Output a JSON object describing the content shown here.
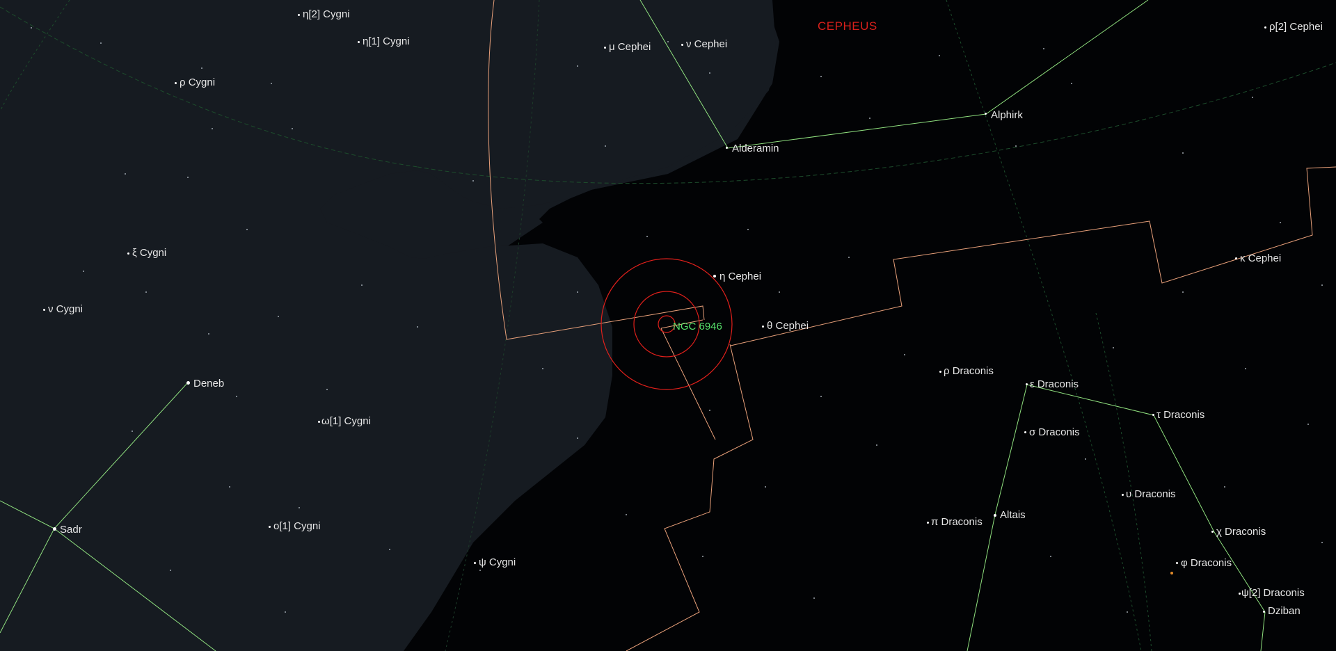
{
  "constellation_label": "CEPHEUS",
  "target": {
    "name": "NGC 6946"
  },
  "stars": [
    {
      "id": "eta2-cygni",
      "name": "η[2] Cygni"
    },
    {
      "id": "eta1-cygni",
      "name": "η[1] Cygni"
    },
    {
      "id": "rho-cygni",
      "name": "ρ Cygni"
    },
    {
      "id": "xi-cygni",
      "name": "ξ Cygni"
    },
    {
      "id": "nu-cygni",
      "name": "ν Cygni"
    },
    {
      "id": "deneb",
      "name": "Deneb"
    },
    {
      "id": "omega1-cygni",
      "name": "ω[1] Cygni"
    },
    {
      "id": "sadr",
      "name": "Sadr"
    },
    {
      "id": "o1-cygni",
      "name": "o[1] Cygni"
    },
    {
      "id": "psi-cygni",
      "name": "ψ Cygni"
    },
    {
      "id": "mu-cephei",
      "name": "μ Cephei"
    },
    {
      "id": "nu-cephei",
      "name": "ν Cephei"
    },
    {
      "id": "alderamin",
      "name": "Alderamin"
    },
    {
      "id": "alphirk",
      "name": "Alphirk"
    },
    {
      "id": "rho2-cephei",
      "name": "ρ[2] Cephei"
    },
    {
      "id": "eta-cephei",
      "name": "η Cephei"
    },
    {
      "id": "theta-cephei",
      "name": "θ Cephei"
    },
    {
      "id": "kappa-cephei",
      "name": "κ Cephei"
    },
    {
      "id": "rho-draconis",
      "name": "ρ Draconis"
    },
    {
      "id": "epsilon-draconis",
      "name": "ε Draconis"
    },
    {
      "id": "tau-draconis",
      "name": "τ Draconis"
    },
    {
      "id": "sigma-draconis",
      "name": "σ Draconis"
    },
    {
      "id": "upsilon-draconis",
      "name": "υ Draconis"
    },
    {
      "id": "pi-draconis",
      "name": "π Draconis"
    },
    {
      "id": "altais",
      "name": "Altais"
    },
    {
      "id": "chi-draconis",
      "name": "χ Draconis"
    },
    {
      "id": "phi-draconis",
      "name": "φ Draconis"
    },
    {
      "id": "psi2-draconis",
      "name": "ψ[2] Draconis"
    },
    {
      "id": "dziban",
      "name": "Dziban"
    }
  ],
  "colors": {
    "background": "#020305",
    "milky_way": "#161b21",
    "constellation_lines": "#8fe07f",
    "boundaries": "#e8a07a",
    "target_circles": "#e0201b",
    "target_label": "#56e06a",
    "constellation_name": "#d8201b",
    "grid": "#1d4d2c"
  }
}
